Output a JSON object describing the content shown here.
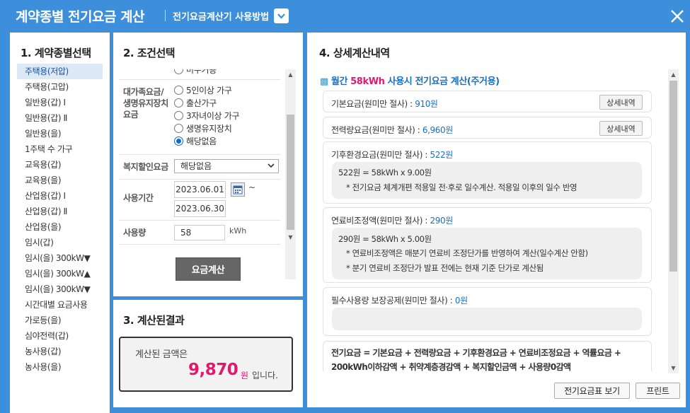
{
  "window": {
    "title": "계약종별 전기요금 계산",
    "help_link": "전기요금계산기 사용방법",
    "icons": {
      "help_toggle": "chevron-down-icon",
      "close": "close-icon"
    },
    "colors": {
      "titlebar": "#3d8fdc",
      "accent_pink": "#e5166f",
      "link_blue": "#1b6fbe"
    }
  },
  "panel1": {
    "title": "1. 계약종별선택",
    "items": [
      "주택용(저압)",
      "주택용(고압)",
      "일반용(갑) Ⅰ",
      "일반용(갑) Ⅱ",
      "일반용(을)",
      "1주택 수 가구",
      "교육용(갑)",
      "교육용(을)",
      "산업용(갑) Ⅰ",
      "산업용(갑) Ⅱ",
      "산업용(을)",
      "임시(갑)",
      "임시(을) 300kW▼",
      "임시(을) 300kW▲",
      "임시(을) 300kW▼",
      "시간대별 요금사용",
      "가로등(을)",
      "심야전력(갑)",
      "농사용(갑)",
      "농사용(을)"
    ],
    "selected_index": 0
  },
  "panel2": {
    "title": "2. 조건선택",
    "partial_option": "미수거용",
    "discount_label": "대가족요금/\n생명유지장치\n요금",
    "discount_options": [
      "5인이상 가구",
      "출산가구",
      "3자녀이상 가구",
      "생명유지장치",
      "해당없음"
    ],
    "discount_selected_index": 4,
    "welfare_label": "복지할인요금",
    "welfare_value": "해당없음",
    "period_label": "사용기간",
    "period_start": "2023.06.01",
    "period_tilde": "~",
    "period_end": "2023.06.30",
    "usage_label": "사용량",
    "usage_value": "58",
    "usage_unit": "kWh",
    "calc_button": "요금계산"
  },
  "panel3": {
    "title": "3. 계산된결과",
    "label": "계산된 금액은",
    "value": "9,870",
    "unit": "원",
    "suffix": "입니다."
  },
  "panel4": {
    "title": "4. 상세계산내역",
    "head_prefix": "월간",
    "head_usage": "58kWh",
    "head_suffix": "사용시 전기요금 계산(주거용)",
    "basic": {
      "label": "기본요금(원미만 절사) :",
      "value": "910원",
      "button": "상세내역"
    },
    "energy": {
      "label": "전력량요금(원미만 절사) :",
      "value": "6,960원",
      "button": "상세내역"
    },
    "climate": {
      "label": "기후환경요금(원미만 절사) :",
      "value": "522원",
      "lines": [
        "522원 = 58kWh x 9.00원",
        "* 전기요금 체계개편 적용일 전·후로 일수계산. 적용일 이후의 일수 반영"
      ]
    },
    "fuel": {
      "label": "연료비조정액(원미만 절사) :",
      "value": "290원",
      "lines": [
        "290원 = 58kWh x 5.00원",
        "* 연료비조정액은 매분기 연료비 조정단가를 반영하여 계산(일수계산 안함)",
        "* 분기 연료비 조정단가 발표 전에는 현재 기준 단가로 계산됨"
      ]
    },
    "essential": {
      "label": "필수사용량 보장공제(원미만 절사) :",
      "value": "0원"
    },
    "formula": "전기요금 = 기본요금 + 전력량요금 + 기후환경요금 + 연료비조정요금 + 역률요금 + 200kWh이하감액 + 취약계층경감액 + 복지할인금액 + 사용량0감액",
    "rate_table_button": "전기요금표 보기",
    "print_button": "프린트"
  }
}
